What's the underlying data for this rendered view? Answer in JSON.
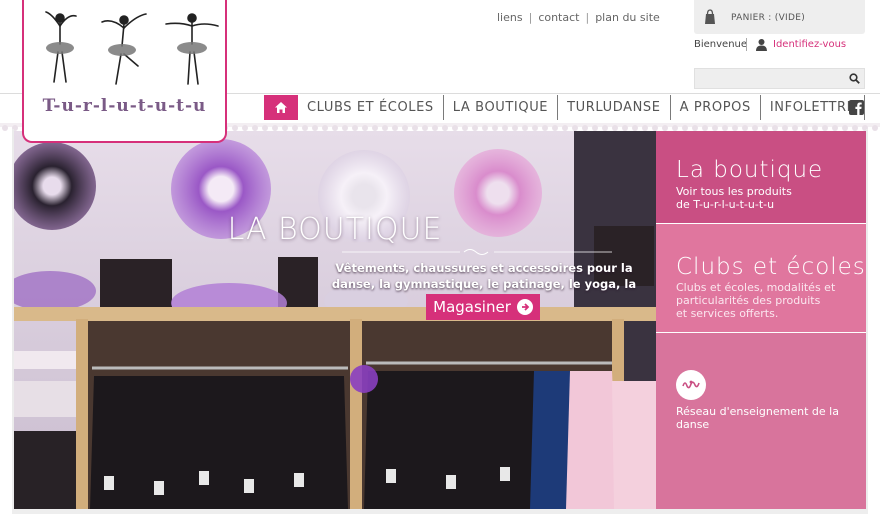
{
  "header": {
    "logo_text": "T-u-r-l-u-t-u-t-u",
    "top_links": [
      "liens",
      "contact",
      "plan du site"
    ],
    "cart_label": "PANIER : (VIDE)",
    "welcome": "Bienvenue",
    "login": "Identifiez-vous",
    "search": {
      "placeholder": "",
      "value": ""
    }
  },
  "nav": {
    "items": [
      "CLUBS ET ÉCOLES",
      "LA BOUTIQUE",
      "TURLUDANSE",
      "A PROPOS",
      "INFOLETTRE"
    ]
  },
  "hero": {
    "title": "LA BOUTIQUE",
    "description": "Vêtements, chaussures et accessoires pour la danse, la gymnastique, le patinage, le yoga, la Zumba",
    "button": "Magasiner"
  },
  "panels": [
    {
      "title": "La boutique",
      "subtitle": "Voir tous les produits\nde T-u-r-l-u-t-u-t-u"
    },
    {
      "title": "Clubs et écoles",
      "subtitle": "Clubs et écoles, modalités et\nparticularités des produits\net services offerts."
    },
    {
      "title": "",
      "subtitle": "Réseau d'enseignement de la\ndanse"
    }
  ],
  "colors": {
    "accent": "#d6307a",
    "panel_1": "#c94f83",
    "panel_2": "#e0769e",
    "panel_3": "#d8749c"
  },
  "icons": [
    "cart-icon",
    "user-icon",
    "search-icon",
    "home-icon",
    "facebook-icon",
    "arrow-right-icon"
  ]
}
